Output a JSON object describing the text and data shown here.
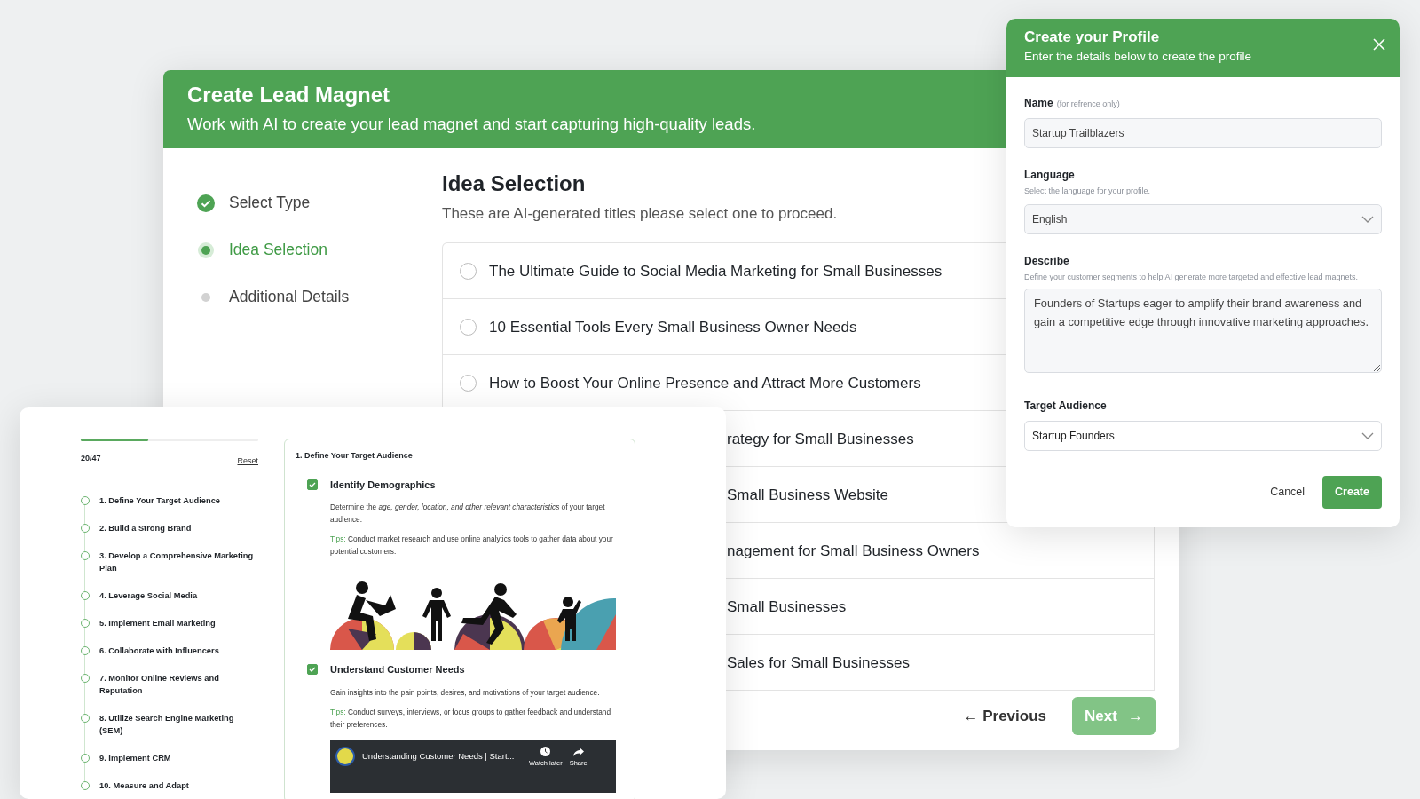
{
  "main_window": {
    "title": "Create Lead Magnet",
    "subtitle": "Work with AI to create your lead magnet and start capturing high-quality leads.",
    "steps": [
      {
        "label": "Select Type",
        "kind": "done"
      },
      {
        "label": "Idea Selection",
        "kind": "active"
      },
      {
        "label": "Additional Details",
        "kind": "pending"
      }
    ],
    "heading": "Idea Selection",
    "description": "These are AI-generated titles please select one to proceed.",
    "options": [
      {
        "label": "The Ultimate Guide to Social Media Marketing for Small Businesses",
        "selected": false
      },
      {
        "label": "10 Essential Tools Every Small Business Owner Needs",
        "selected": false
      },
      {
        "label": "How to Boost Your Online Presence and Attract More Customers",
        "selected": false
      }
    ],
    "covered_options": [
      "rategy for Small Businesses",
      "Small Business Website",
      "nagement for Small Business Owners",
      "Small Businesses",
      "Sales for Small Businesses"
    ],
    "previous_button": "← Previous",
    "next_button": {
      "label": "Next",
      "arrow": "→",
      "disabled": true
    }
  },
  "checklist_window": {
    "progress": {
      "level": 0.38,
      "count": "20/47"
    },
    "reset": "Reset",
    "sections": [
      "1. Define Your Target Audience",
      "2. Build a Strong Brand",
      "3. Develop a Comprehensive Marketing Plan",
      "4. Leverage Social Media",
      "5. Implement Email Marketing",
      "6. Collaborate with Influencers",
      "7. Monitor Online Reviews and Reputation",
      "8. Utilize Search Engine Marketing (SEM)",
      "9. Implement CRM",
      "10. Measure and Adapt"
    ],
    "detail": {
      "title": "1. Define Your Target Audience",
      "tasks": [
        {
          "title": "Identify Demographics",
          "checked": true,
          "text": "Determine the *age, gender, location, and other relevant characteristics* of your target audience.",
          "tip_label": "Tips:",
          "tip": "Conduct market research and use online analytics tools to gather data about your potential customers.",
          "kind": "illustration"
        },
        {
          "title": "Understand Customer Needs",
          "checked": true,
          "text": "Gain insights into the pain points, desires, and motivations of your target audience.",
          "tip_label": "Tips:",
          "tip": "Conduct surveys, interviews, or focus groups to gather feedback and understand their preferences.",
          "kind": "video",
          "video_title": "Understanding Customer Needs | Start...",
          "video_actions": [
            "Watch later",
            "Share"
          ]
        }
      ]
    }
  },
  "profile_dialog": {
    "title": "Create your Profile",
    "subtitle": "Enter the details below to create the profile",
    "fields": [
      {
        "kind": "text",
        "label": "Name",
        "note": "(for refrence only)",
        "value": "Startup Trailblazers"
      },
      {
        "kind": "select",
        "label": "Language",
        "hint": "Select the language for your profile.",
        "value": "English",
        "filled": true
      },
      {
        "kind": "textarea",
        "label": "Describe",
        "hint": "Define your customer segments to help AI generate more targeted and effective lead magnets.",
        "value": "Founders of Startups eager to amplify their brand awareness and gain a competitive edge through innovative marketing approaches."
      },
      {
        "kind": "select",
        "label": "Target Audience",
        "value": "Startup Founders",
        "filled": false
      }
    ],
    "buttons": {
      "cancel": "Cancel",
      "create": "Create"
    }
  }
}
